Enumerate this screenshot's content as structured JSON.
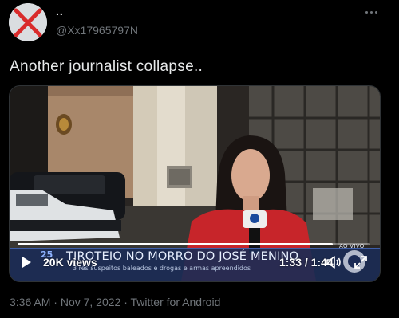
{
  "author": {
    "display_name": "..",
    "handle": "@Xx17965797N",
    "avatar_icon": "red-x-avatar-icon"
  },
  "tweet": {
    "text": "Another journalist collapse.."
  },
  "video": {
    "views_label": "20K views",
    "time_readout": "1:33 / 1:44",
    "progress": 0.894,
    "broadcast": {
      "episode": "25",
      "headline": "TIROTEIO NO MORRO DO JOSÉ MENINO",
      "subline": "3 rés suspeitos baleados e drogas e armas apreendidos",
      "live_tag": "AO VIVO"
    }
  },
  "meta": {
    "time": "3:36 AM",
    "date": "Nov 7, 2022",
    "separator": "·",
    "source": "Twitter for Android"
  },
  "colors": {
    "background": "#000000",
    "text_primary": "#e7e9ea",
    "text_secondary": "#71767b",
    "avatar_x": "#d92b2b"
  }
}
